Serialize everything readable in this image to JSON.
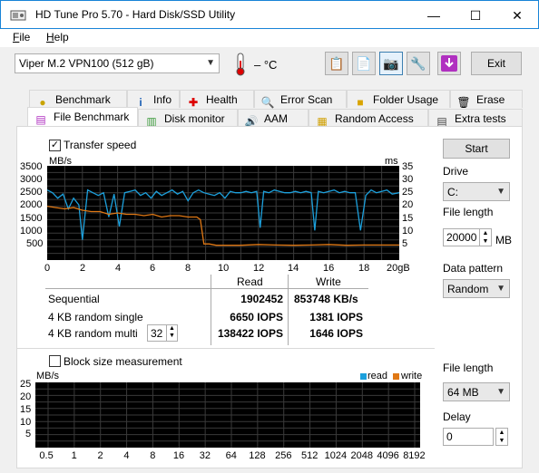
{
  "window": {
    "title": "HD Tune Pro 5.70 - Hard Disk/SSD Utility",
    "minimize": "—",
    "maximize": "☐",
    "close": "✕"
  },
  "menu": {
    "file": "File",
    "help": "Help"
  },
  "toolbar": {
    "drive": "Viper M.2 VPN100 (512 gB)",
    "temperature": "– °C",
    "exit": "Exit"
  },
  "tabs_top": [
    {
      "label": "Benchmark",
      "icon": "benchmark-icon"
    },
    {
      "label": "Info",
      "icon": "info-icon"
    },
    {
      "label": "Health",
      "icon": "health-icon"
    },
    {
      "label": "Error Scan",
      "icon": "error-scan-icon"
    },
    {
      "label": "Folder Usage",
      "icon": "folder-icon"
    },
    {
      "label": "Erase",
      "icon": "erase-icon"
    }
  ],
  "tabs_bottom": [
    {
      "label": "File Benchmark",
      "icon": "file-benchmark-icon",
      "active": true
    },
    {
      "label": "Disk monitor",
      "icon": "disk-monitor-icon"
    },
    {
      "label": "AAM",
      "icon": "aam-icon"
    },
    {
      "label": "Random Access",
      "icon": "random-access-icon"
    },
    {
      "label": "Extra tests",
      "icon": "extra-tests-icon"
    }
  ],
  "transfer": {
    "label": "Transfer speed",
    "checked": true
  },
  "block": {
    "label": "Block size measurement",
    "checked": false
  },
  "right": {
    "start": "Start",
    "drive_label": "Drive",
    "drive_value": "C:",
    "file_length_label": "File length",
    "file_length_value": "20000",
    "file_length_unit": "MB",
    "pattern_label": "Data pattern",
    "pattern_value": "Random",
    "file_length2_label": "File length",
    "file_length2_value": "64 MB",
    "delay_label": "Delay",
    "delay_value": "0"
  },
  "results": {
    "head_read": "Read",
    "head_write": "Write",
    "rows": [
      {
        "label": "Sequential",
        "read": "1902452",
        "write": "853748 KB/s"
      },
      {
        "label": "4 KB random single",
        "read": "6650 IOPS",
        "write": "1381 IOPS"
      },
      {
        "label": "4 KB random multi",
        "read": "138422 IOPS",
        "write": "1646 IOPS"
      }
    ],
    "queue_depth": "32"
  },
  "chart_data": [
    {
      "type": "line",
      "title": "",
      "ylabel": "MB/s",
      "y2label": "ms",
      "xlim": [
        0,
        20
      ],
      "ylim": [
        0,
        3500
      ],
      "y2lim": [
        0,
        35
      ],
      "x_ticks": [
        "0",
        "2",
        "4",
        "6",
        "8",
        "10",
        "12",
        "14",
        "16",
        "18",
        "20gB"
      ],
      "y_ticks": [
        "3500",
        "3000",
        "2500",
        "2000",
        "1500",
        "1000",
        "500"
      ],
      "y2_ticks": [
        "35",
        "30",
        "25",
        "20",
        "15",
        "10",
        "5"
      ],
      "grid": true,
      "colors": {
        "read": "#1ca0dc",
        "write": "#e07814",
        "background": "#000000",
        "grid": "#3a3a3a"
      },
      "series": [
        {
          "name": "read",
          "x": [
            0,
            0.3,
            0.6,
            0.9,
            1.2,
            1.5,
            1.8,
            2.0,
            2.3,
            2.6,
            2.9,
            3.2,
            3.5,
            3.8,
            4.1,
            4.4,
            4.7,
            5.0,
            5.3,
            5.6,
            5.9,
            6.2,
            6.5,
            6.8,
            7.1,
            7.4,
            7.7,
            8.0,
            8.3,
            8.6,
            8.9,
            9.2,
            9.5,
            9.8,
            10.1,
            10.4,
            10.7,
            11.0,
            11.3,
            11.6,
            11.9,
            12.1,
            12.3,
            12.6,
            12.9,
            13.2,
            13.5,
            13.8,
            14.1,
            14.4,
            14.7,
            15.0,
            15.2,
            15.4,
            15.7,
            16.0,
            16.3,
            16.6,
            16.9,
            17.2,
            17.5,
            17.8,
            18.1,
            18.4,
            18.7,
            19.0,
            19.3,
            19.6,
            20.0
          ],
          "y": [
            2600,
            2500,
            2300,
            2450,
            1900,
            2300,
            2050,
            750,
            2600,
            2500,
            2400,
            2500,
            1600,
            2450,
            1250,
            2500,
            2550,
            2600,
            2400,
            2500,
            2300,
            2550,
            2400,
            2500,
            2600,
            2450,
            2550,
            2200,
            2500,
            2600,
            2500,
            2450,
            2400,
            2500,
            2300,
            2550,
            2500,
            2500,
            2550,
            2500,
            2550,
            1200,
            2550,
            2500,
            2600,
            2550,
            2500,
            2500,
            2550,
            2500,
            2550,
            2500,
            1100,
            2550,
            2500,
            2550,
            2600,
            2500,
            2550,
            2500,
            2500,
            1100,
            2400,
            2600,
            2500,
            2550,
            2600,
            2450,
            2500
          ]
        },
        {
          "name": "write",
          "x": [
            0,
            0.5,
            1.0,
            1.5,
            2.0,
            2.5,
            3.0,
            3.5,
            4.0,
            4.5,
            5.0,
            5.5,
            6.0,
            6.5,
            7.0,
            7.5,
            8.0,
            8.5,
            8.7,
            8.9,
            9.2,
            9.6,
            10,
            11,
            12,
            13,
            14,
            15,
            16,
            17,
            18,
            19,
            20
          ],
          "y": [
            2000,
            1950,
            1900,
            1950,
            1850,
            1800,
            1800,
            1700,
            1750,
            1700,
            1700,
            1650,
            1700,
            1600,
            1650,
            1650,
            1600,
            1600,
            1500,
            600,
            600,
            550,
            550,
            550,
            580,
            560,
            550,
            560,
            580,
            550,
            560,
            560,
            560
          ]
        }
      ]
    },
    {
      "type": "bar",
      "title": "",
      "ylabel": "MB/s",
      "ylim": [
        0,
        25
      ],
      "y_ticks": [
        "25",
        "20",
        "15",
        "10",
        "5"
      ],
      "categories": [
        "0.5",
        "1",
        "2",
        "4",
        "8",
        "16",
        "32",
        "64",
        "128",
        "256",
        "512",
        "1024",
        "2048",
        "4096",
        "8192"
      ],
      "grid": true,
      "legend": "top-right",
      "series": [
        {
          "name": "read",
          "color": "#1ca0dc",
          "values": []
        },
        {
          "name": "write",
          "color": "#e07814",
          "values": []
        }
      ]
    }
  ]
}
